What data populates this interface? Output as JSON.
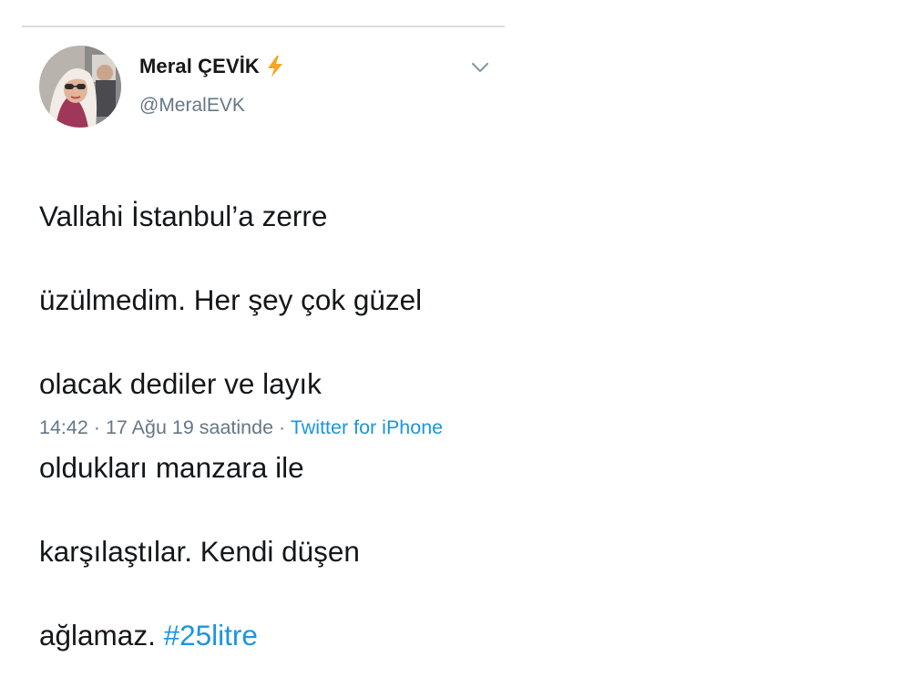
{
  "tweet": {
    "author": {
      "display_name": "Meral ÇEVİK",
      "badge_icon": "lightning-bolt-icon",
      "handle": "@MeralEVK",
      "avatar_icon": "profile-photo-avatar"
    },
    "menu_icon": "chevron-down-icon",
    "text_line_1": "Vallahi İstanbul’a zerre",
    "text_line_2": "üzülmedim. Her şey çok güzel",
    "text_line_3": "olacak dediler ve layık",
    "text_line_4": "oldukları manzara ile",
    "text_line_5": "karşılaştılar. Kendi düşen",
    "text_line_6_prefix": "ağlamaz.",
    "hashtag": "#25litre",
    "time": "14:42",
    "separator": "·",
    "date": "17 Ağu 19 saatinde",
    "source": "Twitter for iPhone"
  },
  "colors": {
    "text": "#14171a",
    "secondary": "#657786",
    "link": "#1b95e0",
    "bolt": "#f5a623",
    "divider": "#dcdcdc"
  }
}
